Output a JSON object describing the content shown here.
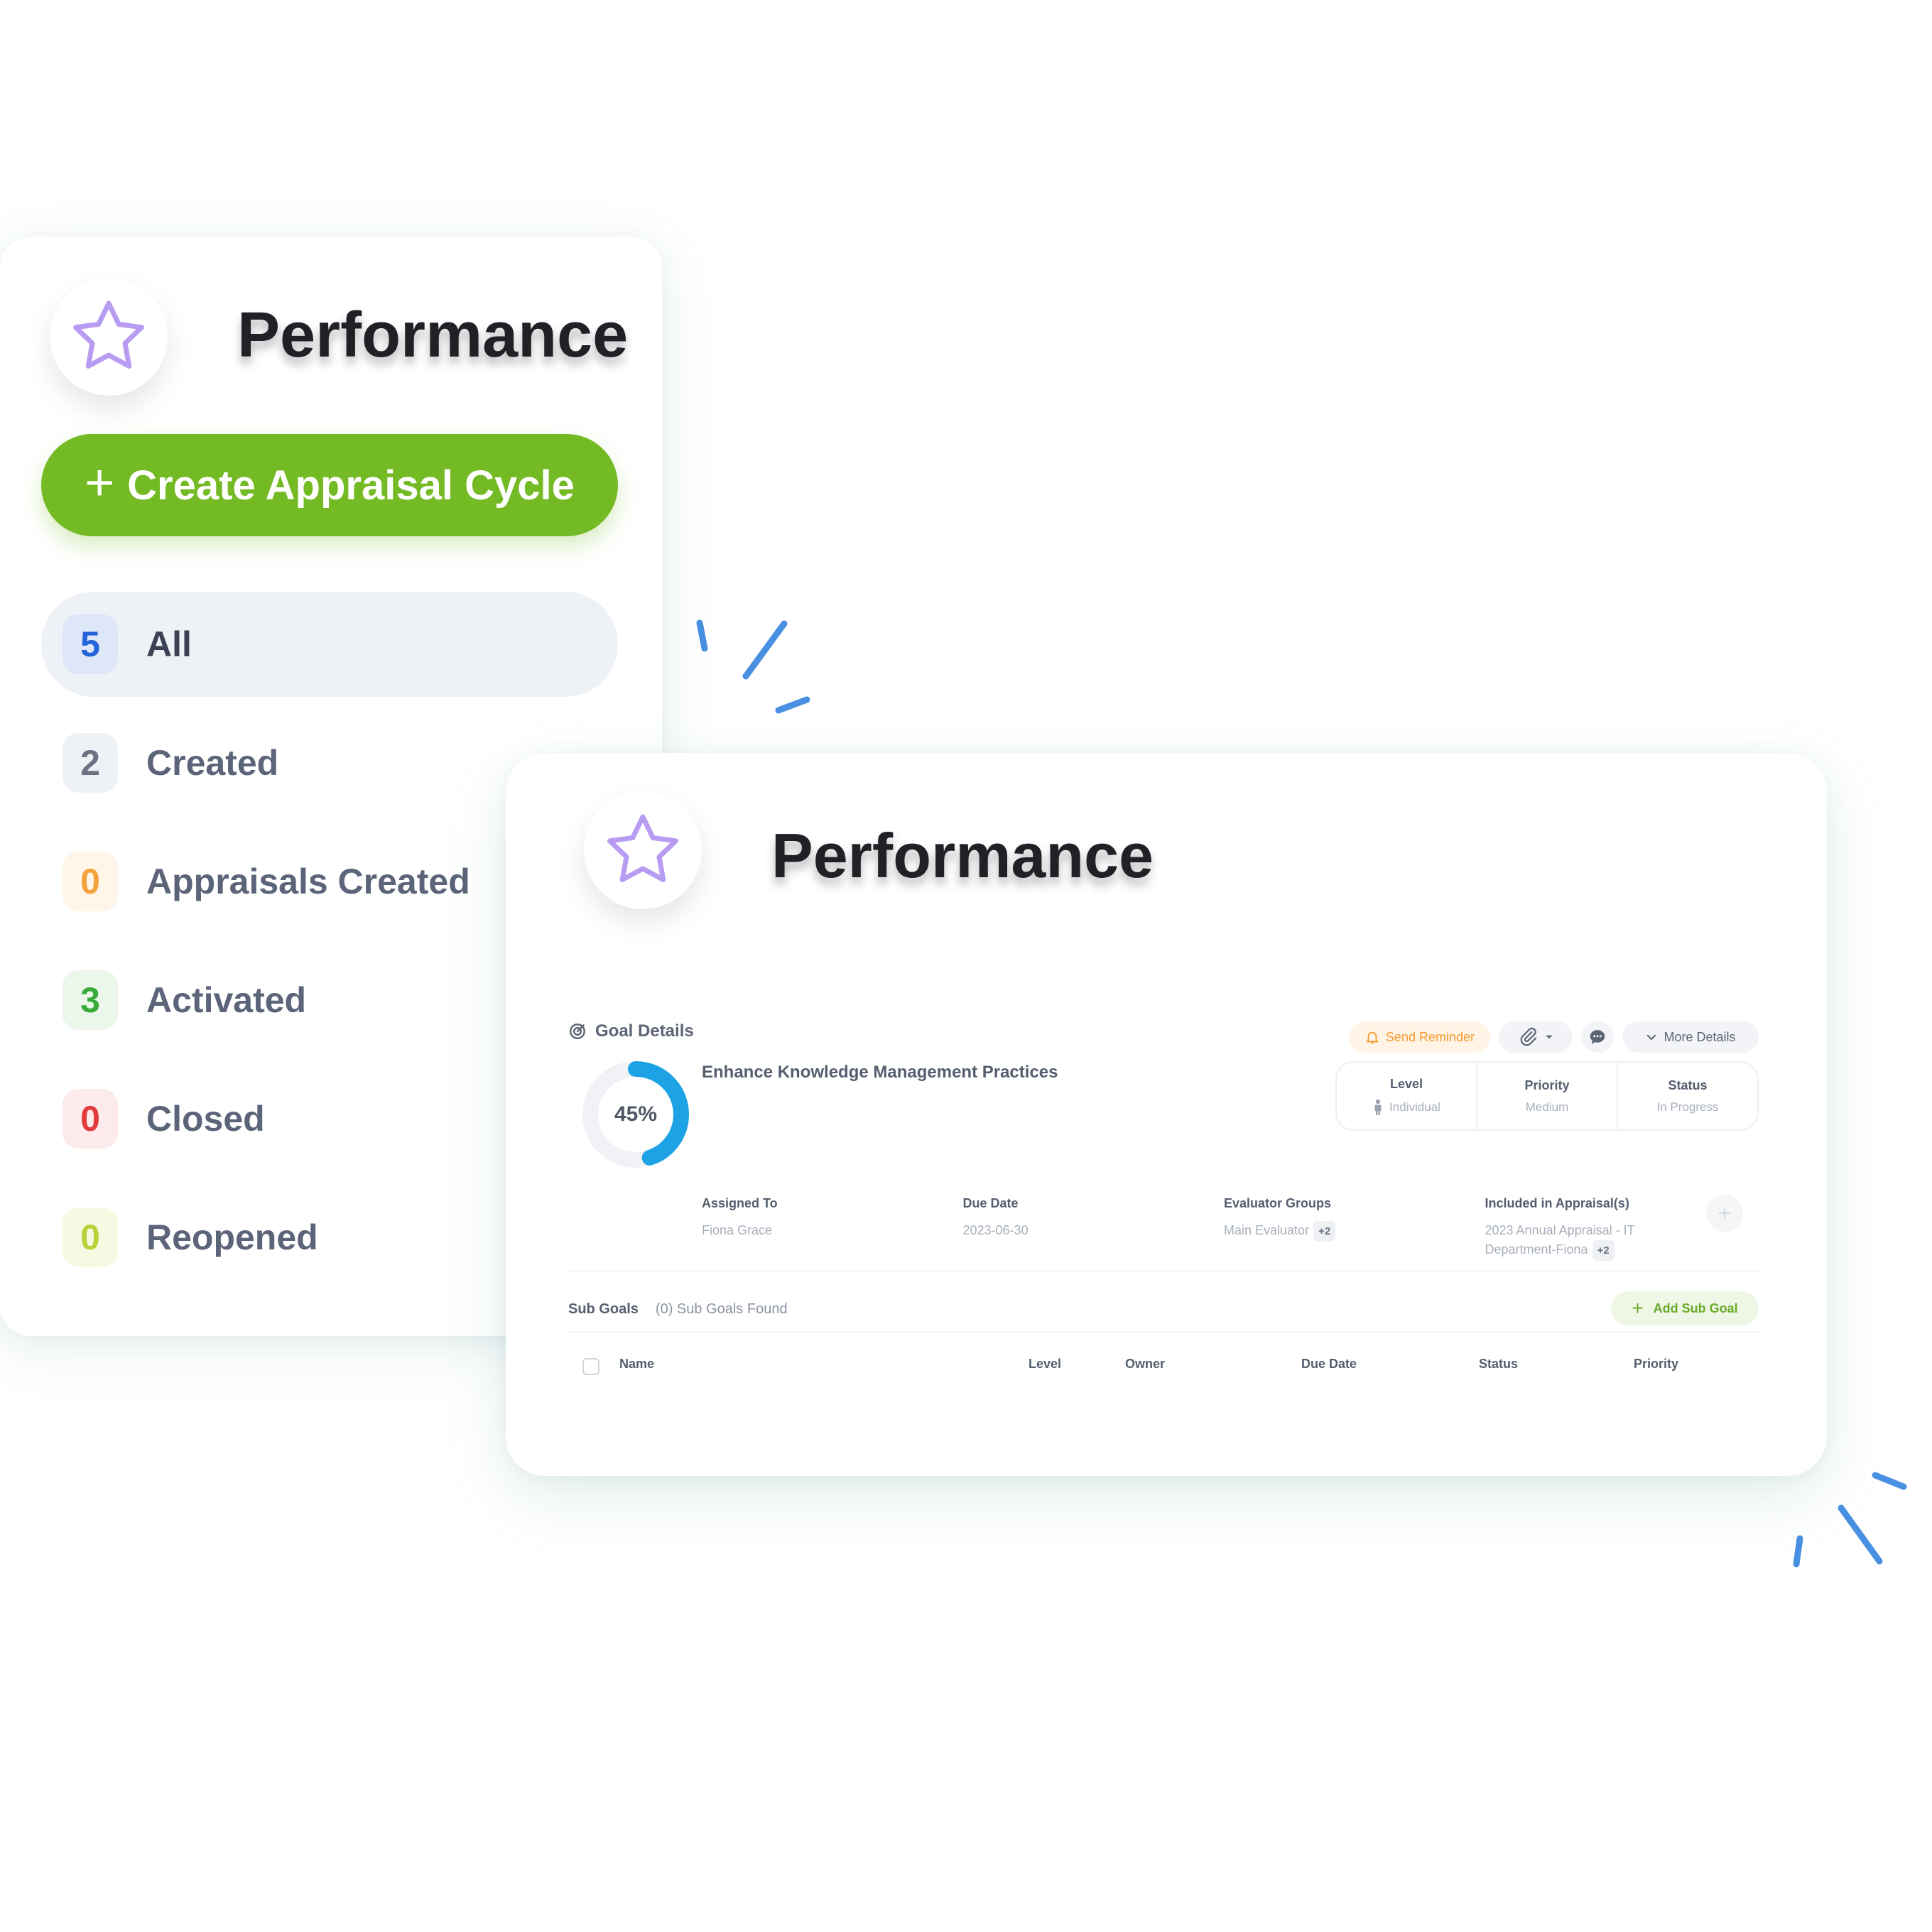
{
  "left_panel": {
    "title": "Performance",
    "star_icon": "star-icon",
    "create_button": {
      "plus": "+",
      "label": "Create Appraisal Cycle"
    },
    "filters": [
      {
        "count": "5",
        "label": "All",
        "active": true,
        "color": "#2463d8",
        "bg": "#dde7f7"
      },
      {
        "count": "2",
        "label": "Created",
        "active": false,
        "color": "#6b7383",
        "bg": "#eef1f5"
      },
      {
        "count": "0",
        "label": "Appraisals Created",
        "active": false,
        "color": "#f5a23a",
        "bg": "#fff5e9"
      },
      {
        "count": "3",
        "label": "Activated",
        "active": false,
        "color": "#3aaa3a",
        "bg": "#eaf7ea"
      },
      {
        "count": "0",
        "label": "Closed",
        "active": false,
        "color": "#e23b3b",
        "bg": "#fdeaea"
      },
      {
        "count": "0",
        "label": "Reopened",
        "active": false,
        "color": "#b8d23a",
        "bg": "#f6fae3"
      }
    ]
  },
  "right_panel": {
    "title": "Performance",
    "goal_details_label": "Goal Details",
    "progress": {
      "value": 45,
      "label": "45%"
    },
    "goal_title": "Enhance Knowledge Management Practices",
    "actions": {
      "send_reminder": "Send Reminder",
      "more_details": "More Details"
    },
    "meta": {
      "level_label": "Level",
      "level_value": "Individual",
      "priority_label": "Priority",
      "priority_value": "Medium",
      "status_label": "Status",
      "status_value": "In Progress"
    },
    "details": {
      "assigned_to_label": "Assigned To",
      "assigned_to_value": "Fiona Grace",
      "due_date_label": "Due Date",
      "due_date_value": "2023-06-30",
      "evaluator_groups_label": "Evaluator Groups",
      "evaluator_groups_value": "Main Evaluator",
      "evaluator_groups_badge": "+2",
      "included_label": "Included in Appraisal(s)",
      "included_value_line1": "2023 Annual Appraisal - IT",
      "included_value_line2": "Department-Fiona",
      "included_badge": "+2"
    },
    "sub_goals": {
      "title": "Sub Goals",
      "found": "(0) Sub Goals Found",
      "add_button": "Add Sub Goal",
      "add_plus": "+"
    },
    "table_headers": {
      "name": "Name",
      "level": "Level",
      "owner": "Owner",
      "due_date": "Due Date",
      "status": "Status",
      "priority": "Priority"
    }
  },
  "colors": {
    "accent_green": "#74ba24",
    "progress_blue": "#1ea2e6",
    "star_purple": "#b79cf2",
    "decor_blue": "#4a90e2"
  }
}
